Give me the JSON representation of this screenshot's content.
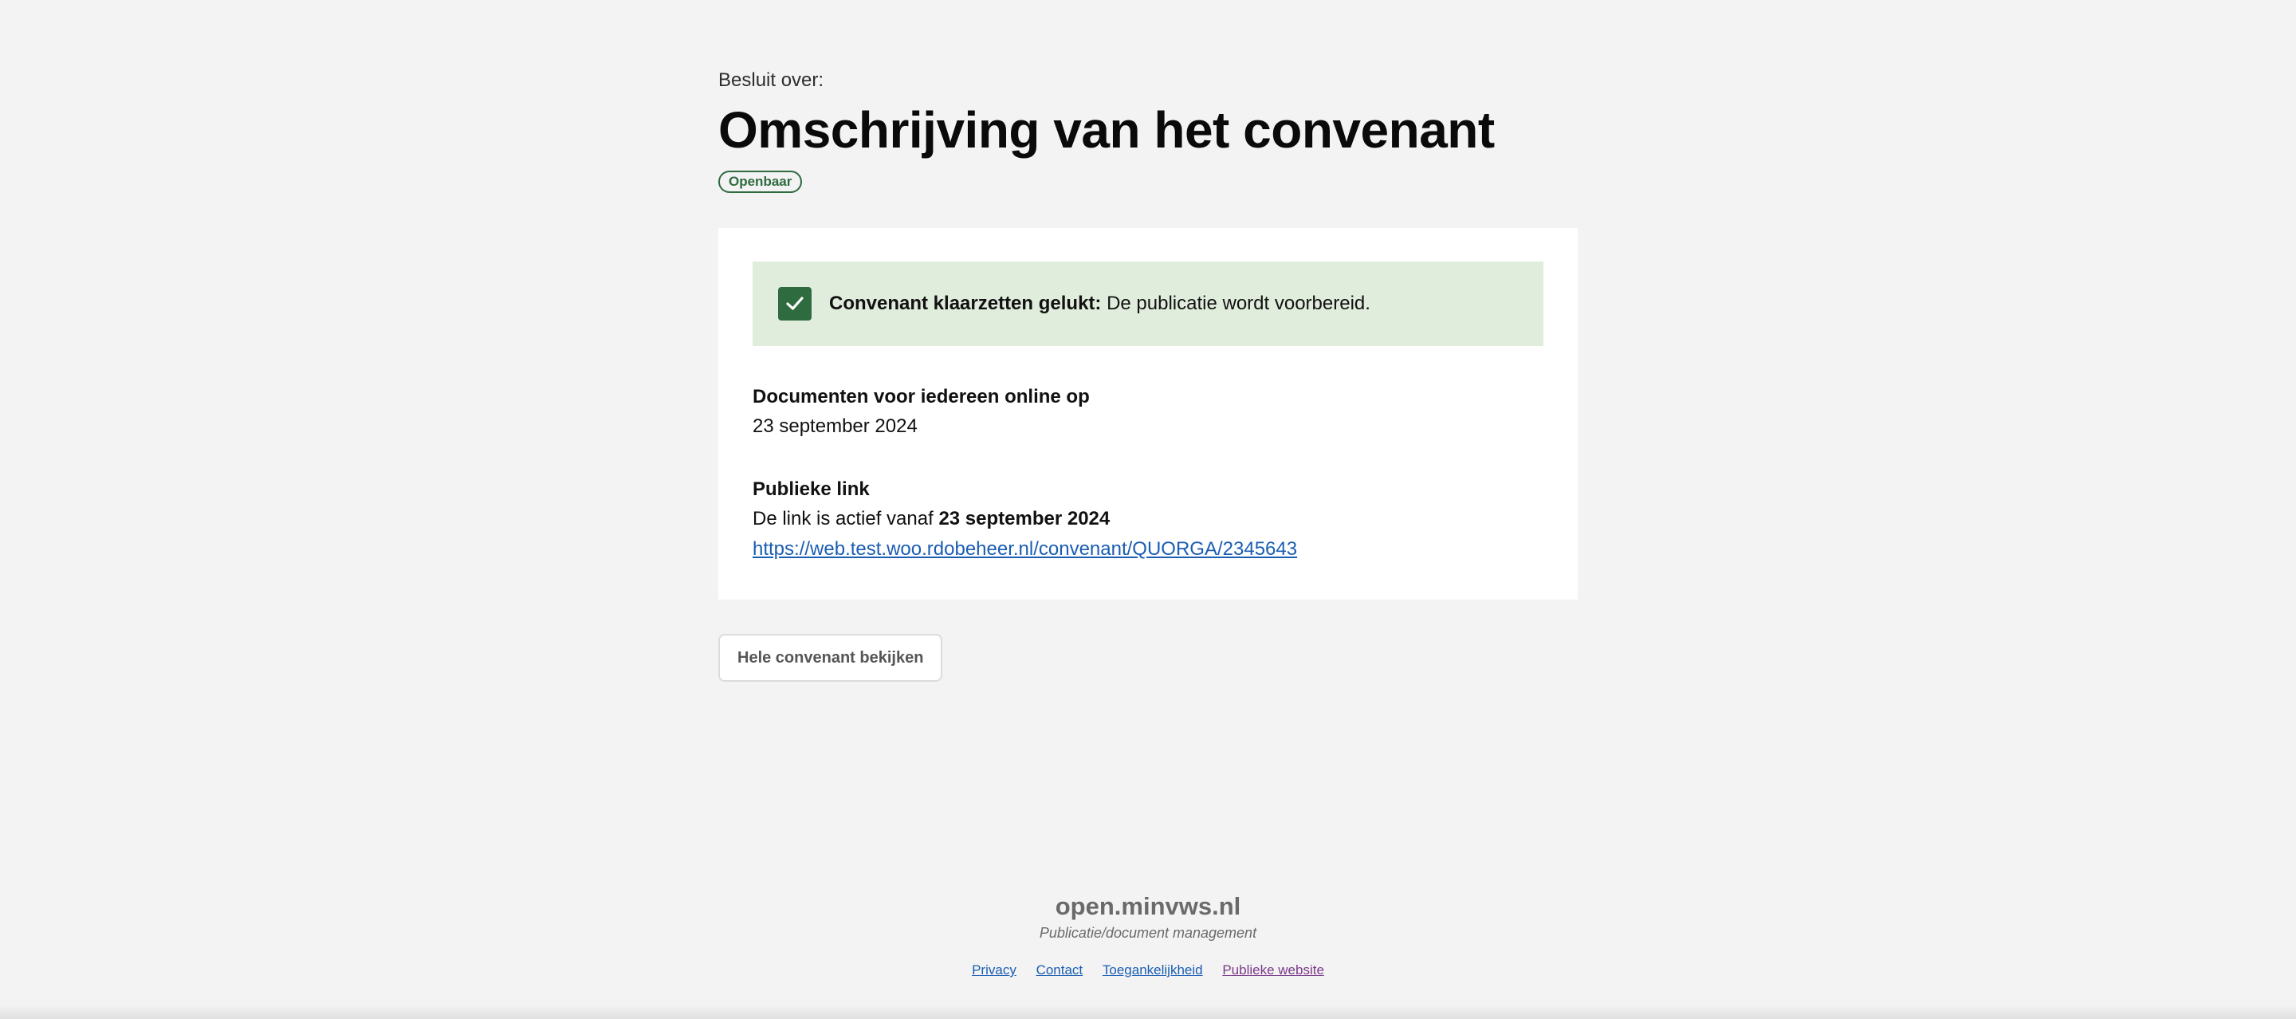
{
  "header": {
    "eyebrow": "Besluit over:",
    "title": "Omschrijving van het convenant",
    "status_badge": "Openbaar"
  },
  "alert": {
    "icon": "checkmark-icon",
    "bold_text": "Convenant klaarzetten gelukt:",
    "text": " De publicatie wordt voorbereid.",
    "color": "#2e6b3f",
    "background": "#e1eddc"
  },
  "documents_online": {
    "label": "Documenten voor iedereen online op",
    "date": "23 september 2024"
  },
  "public_link": {
    "label": "Publieke link",
    "active_prefix": "De link is actief vanaf ",
    "active_date": "23 september 2024",
    "url": "https://web.test.woo.rdobeheer.nl/convenant/QUORGA/2345643"
  },
  "actions": {
    "view_button": "Hele convenant bekijken"
  },
  "footer": {
    "brand": "open.minvws.nl",
    "subtitle": "Publicatie/document management",
    "links": [
      "Privacy",
      "Contact",
      "Toegankelijkheid",
      "Publieke website"
    ]
  }
}
